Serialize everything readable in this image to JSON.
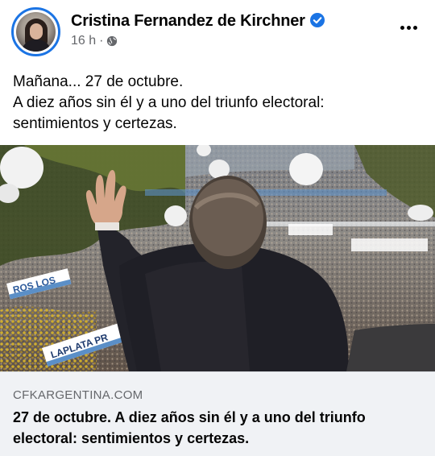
{
  "post": {
    "author": "Cristina Fernandez de Kirchner",
    "verified": true,
    "time": "16 h",
    "separator": "·",
    "audience_icon": "globe-icon",
    "more_icon": "more-options-icon",
    "text_lines": [
      "Mañana... 27 de octubre.",
      "A diez años sin él y a uno del triunfo electoral:",
      "sentimientos y certezas."
    ]
  },
  "link": {
    "domain": "CFKARGENTINA.COM",
    "title": "27 de octubre. A diez años sin él y a uno del triunfo electoral: sentimientos y certezas.",
    "banners": [
      "ROS LOS",
      "LAPLATA PR"
    ]
  },
  "colors": {
    "accent": "#1b74e4",
    "secondary_text": "#65676b",
    "footer_bg": "#f0f2f5"
  }
}
